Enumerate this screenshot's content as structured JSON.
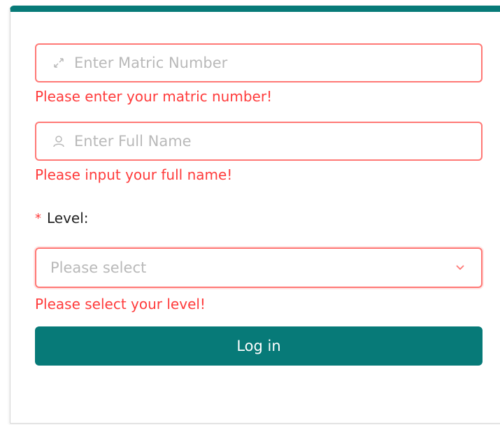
{
  "form": {
    "matric": {
      "placeholder": "Enter Matric Number",
      "value": "",
      "icon": "expand-arrows-icon",
      "error": "Please enter your matric number!"
    },
    "fullname": {
      "placeholder": "Enter Full Name",
      "value": "",
      "icon": "user-icon",
      "error": "Please input your full name!"
    },
    "level": {
      "required_mark": "*",
      "label": "Level",
      "colon": ":",
      "placeholder": "Please select",
      "error": "Please select your level!"
    },
    "submit_label": "Log in"
  },
  "colors": {
    "accent": "#077a78",
    "error": "#ff3b3b",
    "error_border": "#ff7875",
    "placeholder": "#b9b9b9"
  }
}
